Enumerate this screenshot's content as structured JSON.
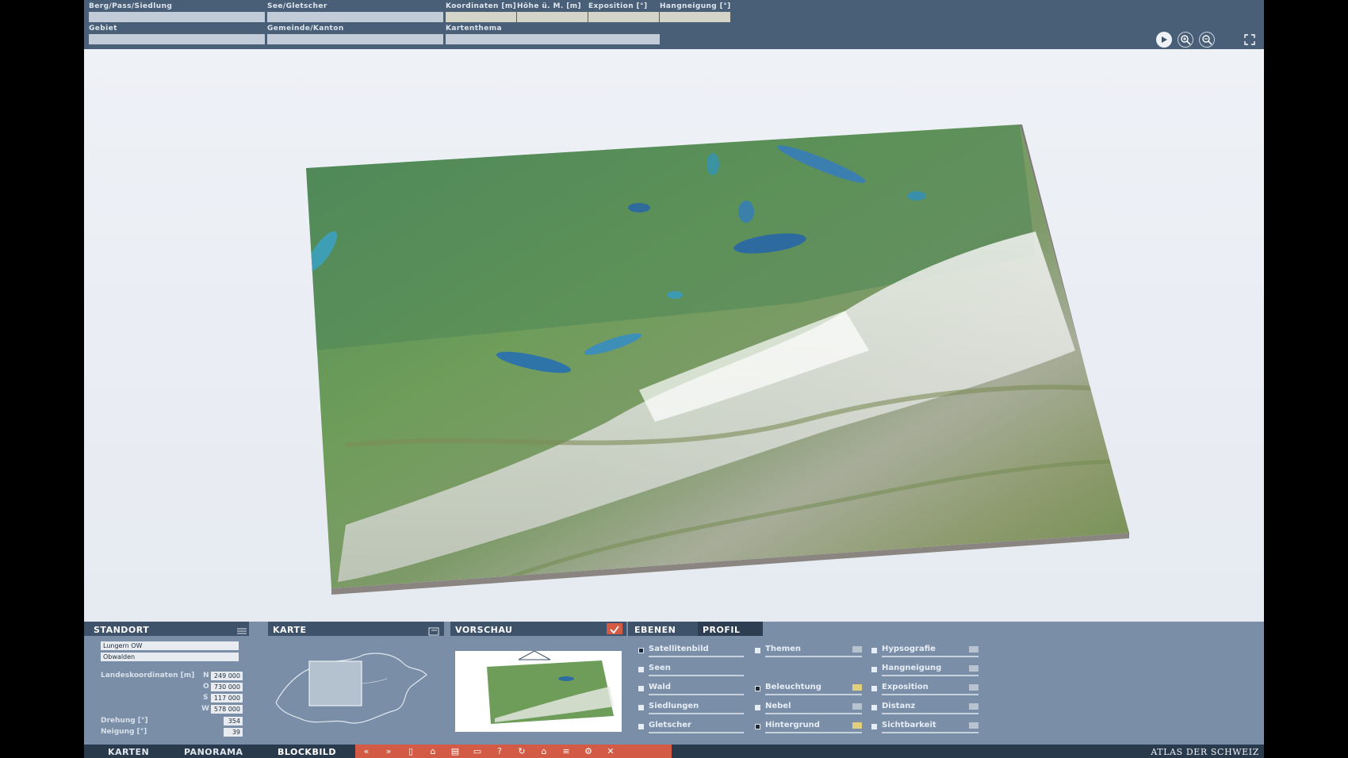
{
  "search": {
    "berg_label": "Berg/Pass/Siedlung",
    "see_label": "See/Gletscher",
    "koordinaten_label": "Koordinaten [m]",
    "hoehe_label": "Höhe ü. M. [m]",
    "exposition_label": "Exposition [°]",
    "hangneigung_label": "Hangneigung [°]",
    "gebiet_label": "Gebiet",
    "gemeinde_label": "Gemeinde/Kanton",
    "kartenthema_label": "Kartenthema",
    "berg_value": "",
    "see_value": "",
    "gebiet_value": "",
    "gemeinde_value": "",
    "kartenthema_value": ""
  },
  "standort": {
    "title": "STANDORT",
    "place": "Lungern  OW",
    "canton": "Obwalden",
    "coords_label": "Landeskoordinaten [m]",
    "n_label": "N",
    "n_value": "249 000",
    "o_label": "O",
    "o_value": "730 000",
    "s_label": "S",
    "s_value": "117 000",
    "w_label": "W",
    "w_value": "578 000",
    "drehung_label": "Drehung [°]",
    "drehung_value": "354",
    "neigung_label": "Neigung [°]",
    "neigung_value": "39"
  },
  "karte": {
    "title": "KARTE"
  },
  "vorschau": {
    "title": "VORSCHAU"
  },
  "ebenen": {
    "tab_ebenen": "EBENEN",
    "tab_profil": "PROFIL",
    "col1": [
      "Satellitenbild",
      "Seen",
      "Wald",
      "Siedlungen",
      "Gletscher"
    ],
    "col2": [
      "Themen",
      "Beleuchtung",
      "Nebel",
      "Hintergrund"
    ],
    "col3": [
      "Hypsografie",
      "Hangneigung",
      "Exposition",
      "Distanz",
      "Sichtbarkeit"
    ]
  },
  "nav": {
    "karten": "KARTEN",
    "panorama": "PANORAMA",
    "blockbild": "BLOCKBILD"
  },
  "brand": "ATLAS DER SCHWEIZ",
  "colors": {
    "header": "#495f77",
    "panel": "#7a8ea8",
    "tool_strip": "#d35a44"
  }
}
